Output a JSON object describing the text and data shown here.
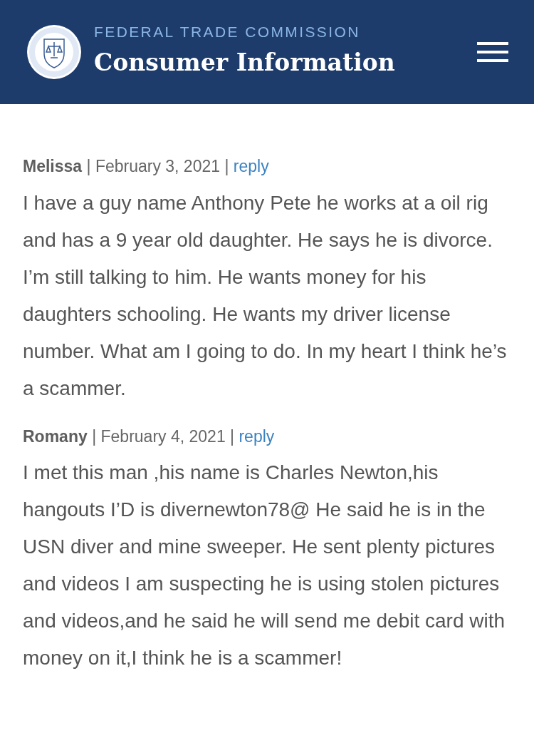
{
  "header": {
    "agency": "FEDERAL TRADE COMMISSION",
    "site_title": "Consumer Information"
  },
  "comments": [
    {
      "author": "Melissa",
      "separator_1": "|",
      "date": "February 3, 2021",
      "separator_2": "|",
      "reply": "reply",
      "body": "I have a guy name Anthony Pete he works at a oil rig and has a 9 year old daughter. He says he is divorce. I’m still talking to him. He wants money for his daughters schooling. He wants my driver license number. What am I going to do. In my heart I think he’s a scammer."
    },
    {
      "author": "Romany",
      "separator_1": "|",
      "date": "February 4, 2021",
      "separator_2": "|",
      "reply": "reply",
      "body": "I met this man ,his name is Charles Newton,his hangouts I’D is divernewton78@ He said he is in the USN diver and mine sweeper. He sent plenty pictures and videos I am suspecting he is using stolen pictures and videos,and he said he will send me debit card with money on it,I think he is a scammer!"
    }
  ]
}
